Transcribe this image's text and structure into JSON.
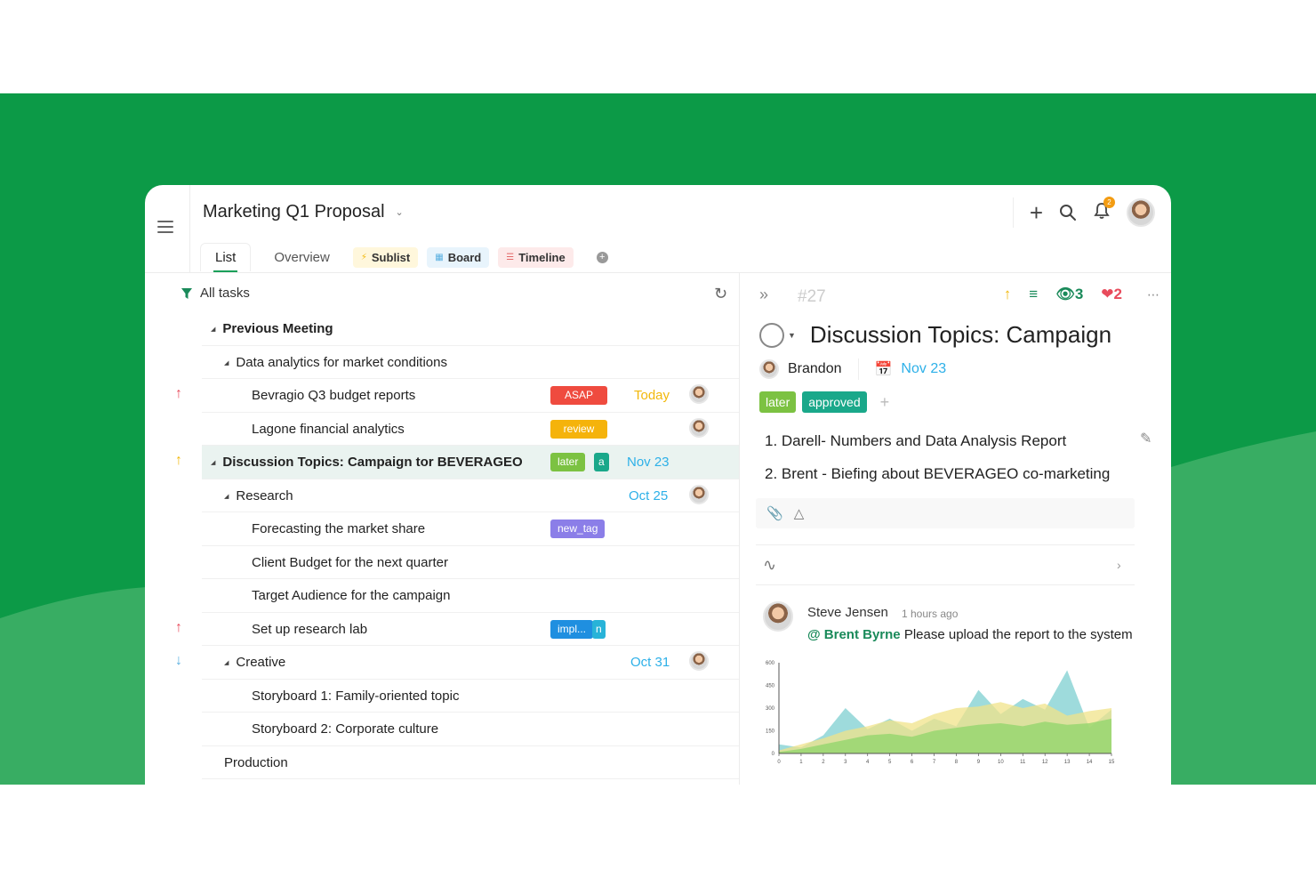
{
  "project": {
    "title": "Marketing Q1 Proposal"
  },
  "tabs": {
    "list": "List",
    "overview": "Overview",
    "sublist": "Sublist",
    "board": "Board",
    "timeline": "Timeline"
  },
  "header": {
    "notification_count": "2"
  },
  "list": {
    "filter_label": "All tasks",
    "rows": [
      {
        "name": "Previous Meeting",
        "indent": 1,
        "bold": true,
        "collapsible": true
      },
      {
        "name": "Data analytics for market conditions",
        "indent": 2,
        "collapsible": true
      },
      {
        "name": "Bevragio Q3 budget reports",
        "indent": 3,
        "priority": "up",
        "tag": "ASAP",
        "date": "Today",
        "date_color": "#f2b80b",
        "avatar": true
      },
      {
        "name": "Lagone financial analytics",
        "indent": 3,
        "tag": "review",
        "avatar": true
      },
      {
        "name": "Discussion Topics: Campaign tor BEVERAGEO",
        "indent": 1,
        "bold": true,
        "collapsible": true,
        "selected": true,
        "priority": "up-orange",
        "tags": [
          "later",
          "a"
        ],
        "date": "Nov 23",
        "date_color": "#2db0e8"
      },
      {
        "name": "Research",
        "indent": 2,
        "collapsible": true,
        "date": "Oct 25",
        "date_color": "#2db0e8",
        "avatar": true
      },
      {
        "name": "Forecasting the market share",
        "indent": 3,
        "tag": "new_tag"
      },
      {
        "name": "Client Budget for the next quarter",
        "indent": 3
      },
      {
        "name": "Target Audience for the campaign",
        "indent": 3
      },
      {
        "name": "Set up research lab",
        "indent": 3,
        "priority": "up",
        "tags": [
          "impl...",
          "n"
        ]
      },
      {
        "name": "Creative",
        "indent": 2,
        "collapsible": true,
        "priority": "down",
        "date": "Oct 31",
        "date_color": "#2db0e8",
        "avatar": true
      },
      {
        "name": "Storyboard 1: Family-oriented topic",
        "indent": 3
      },
      {
        "name": "Storyboard 2: Corporate culture",
        "indent": 3
      },
      {
        "name": "Production",
        "indent": 2
      }
    ]
  },
  "detail": {
    "number": "#27",
    "watchers": "3",
    "likes": "2",
    "title": "Discussion Topics: Campaign",
    "assignee": "Brandon",
    "due": "Nov 23",
    "tags": [
      {
        "label": "later",
        "color": "#7cc242"
      },
      {
        "label": "approved",
        "color": "#1aa88a"
      }
    ],
    "description": [
      "1.  Darell- Numbers and Data Analysis Report",
      "2.  Brent - Biefing about BEVERAGEO co-marketing"
    ],
    "comment": {
      "author": "Steve Jensen",
      "time": "1 hours ago",
      "mention": "@ Brent Byrne",
      "text": " Please upload the report to the system"
    }
  },
  "chart_data": {
    "type": "area",
    "x": [
      0,
      1,
      2,
      3,
      4,
      5,
      6,
      7,
      8,
      9,
      10,
      11,
      12,
      13,
      14,
      15
    ],
    "ylim": [
      0,
      600
    ],
    "yticks": [
      0,
      150,
      300,
      450,
      600
    ],
    "series": [
      {
        "color": "#7ecfd0",
        "values": [
          60,
          40,
          120,
          300,
          160,
          230,
          150,
          230,
          180,
          420,
          260,
          360,
          290,
          550,
          170,
          290
        ]
      },
      {
        "color": "#f0e38a",
        "values": [
          20,
          60,
          100,
          150,
          180,
          220,
          200,
          260,
          300,
          310,
          340,
          300,
          330,
          250,
          280,
          300
        ]
      },
      {
        "color": "#8fd46a",
        "values": [
          10,
          30,
          60,
          90,
          120,
          130,
          110,
          150,
          170,
          190,
          200,
          180,
          210,
          190,
          200,
          230
        ]
      }
    ]
  }
}
